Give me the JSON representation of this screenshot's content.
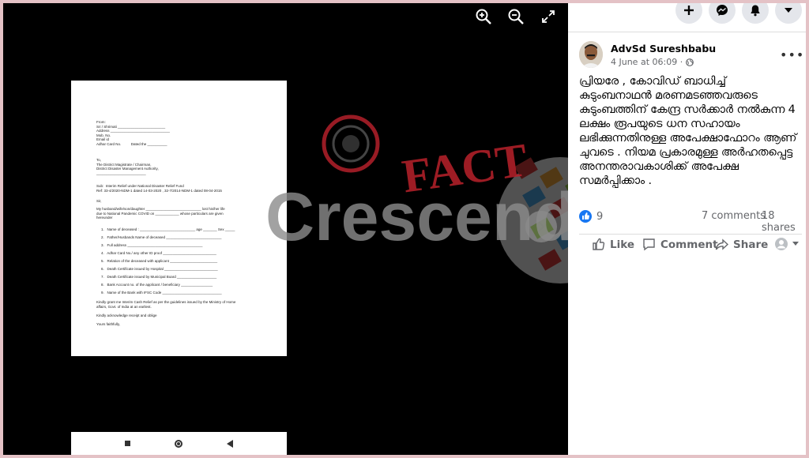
{
  "post": {
    "author": "AdvSd Sureshbabu",
    "date": "4 June at 06:09 ·",
    "text": "പ്രിയരേ , കോവിഡ് ബാധിച്ച് കുടുംബനാഥൻ മരണമടഞ്ഞവരുടെ കുടുംബത്തിന് കേന്ദ്ര സർക്കാർ നൽകുന്ന 4 ലക്ഷം രൂപയുടെ ധന സഹായം ലഭിക്കുന്നതിനുള്ള അപേക്ഷാഫോറം ആണ് ചുവടെ . നിയമ പ്രകാരമുള്ള അർഹതപ്പെട്ട അനന്തരാവകാശിക്ക് അപേക്ഷ സമർപ്പിക്കാം .",
    "reactions": "9",
    "comments": "7 comments",
    "shares": "18 shares"
  },
  "actions": {
    "like": "Like",
    "comment": "Comment",
    "share": "Share"
  },
  "watermark": {
    "line1": "FACT",
    "line2": "Crescendo"
  },
  "document": {
    "from_block": "From:\nSri / Shrimati ________________________\nAddress ______________________________\nMob. No.\nEmail id\nAdhar Card No.          Dated the __________",
    "to_block": "To,\nThe District Magistrate / Chairman,\nDistrict Disaster Management Authority,\n_________________________",
    "subject": "Sub:  Interim Relief under National Disaster Relief Fund\nRef: 33-4/2020-NDM-1 dated 14-03-2020 , 32-7/2014-NDM-1 dated 08-04-2015",
    "salutation": "Sir,",
    "body": "My husband/wife/son/daughter ____________________________ lost his/her life\ndue to National Pandemic COVID on ____________ whose particulars are given\nhereunder",
    "items": [
      "Name of deceased : ____________________________ age _______ Sex _____",
      "Father/Husbands Name of deceased ____________________________",
      "Full address ______________________________________",
      "Adhar Card No./ any other ID proof ___________________________",
      "Relation of the deceased with applicant ________________________",
      "Death Certificate issued by Hospital ___________________________",
      "Death Certificate issued by Municipal Board ____________________",
      "Bank Account no. of the applicant / beneficiary ________________",
      "Name of the Bank with IFSC Code ______________________________"
    ],
    "closing": "Kindly grant me Interim Cash Relief as per the guidelines issued by the Ministry of Home\naffairs, Govt. of India at an earliest.\n\nKindly acknowledge receipt and oblige\n\nYours faithfully,"
  },
  "colors": {
    "accent": "#1877f2",
    "viewer_bg": "#000000",
    "border": "#e4c2c6",
    "watermark_red": "#b3202a"
  }
}
